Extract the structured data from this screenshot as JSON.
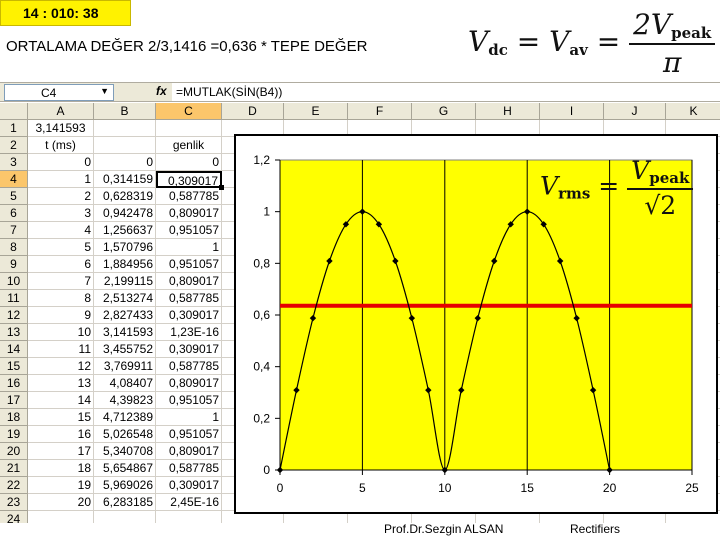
{
  "slide": {
    "timer": "14 : 010: 38",
    "headline": "ORTALAMA DEĞER 2/3,1416 =0,636 * TEPE DEĞER",
    "footer_credit": "Prof.Dr.Sezgin ALSAN",
    "footer_topic": "Rectifiers"
  },
  "formula_vdc": {
    "lhs1": "V",
    "lhs1_sub": "dc",
    "eq1": "=",
    "lhs2": "V",
    "lhs2_sub": "av",
    "eq2": "=",
    "num": "2V",
    "num_sub": "peak",
    "den": "π"
  },
  "formula_vrms": {
    "lhs": "V",
    "lhs_sub": "rms",
    "eq": "=",
    "num": "V",
    "num_sub": "peak",
    "den": "√2"
  },
  "formula_bar": {
    "name_box": "C4",
    "fx_label": "fx",
    "formula": "=MUTLAK(SİN(B4))"
  },
  "sheet": {
    "columns": [
      "A",
      "B",
      "C",
      "D",
      "E",
      "F",
      "G",
      "H",
      "I",
      "J",
      "K"
    ],
    "active_column": "C",
    "active_row": 4,
    "selected_cell": "C4",
    "row_numbers": [
      1,
      2,
      3,
      4,
      5,
      6,
      7,
      8,
      9,
      10,
      11,
      12,
      13,
      14,
      15,
      16,
      17,
      18,
      19,
      20,
      21,
      22,
      23,
      24
    ],
    "rows": [
      [
        "3,141593",
        "",
        ""
      ],
      [
        "t (ms)",
        "",
        "genlik"
      ],
      [
        "0",
        "0",
        "0"
      ],
      [
        "1",
        "0,314159",
        "0,309017"
      ],
      [
        "2",
        "0,628319",
        "0,587785"
      ],
      [
        "3",
        "0,942478",
        "0,809017"
      ],
      [
        "4",
        "1,256637",
        "0,951057"
      ],
      [
        "5",
        "1,570796",
        "1"
      ],
      [
        "6",
        "1,884956",
        "0,951057"
      ],
      [
        "7",
        "2,199115",
        "0,809017"
      ],
      [
        "8",
        "2,513274",
        "0,587785"
      ],
      [
        "9",
        "2,827433",
        "0,309017"
      ],
      [
        "10",
        "3,141593",
        "1,23E-16"
      ],
      [
        "11",
        "3,455752",
        "0,309017"
      ],
      [
        "12",
        "3,769911",
        "0,587785"
      ],
      [
        "13",
        "4,08407",
        "0,809017"
      ],
      [
        "14",
        "4,39823",
        "0,951057"
      ],
      [
        "15",
        "4,712389",
        "1"
      ],
      [
        "16",
        "5,026548",
        "0,951057"
      ],
      [
        "17",
        "5,340708",
        "0,809017"
      ],
      [
        "18",
        "5,654867",
        "0,587785"
      ],
      [
        "19",
        "5,969026",
        "0,309017"
      ],
      [
        "20",
        "6,283185",
        "2,45E-16"
      ]
    ]
  },
  "chart_data": {
    "type": "scatter",
    "x": [
      0,
      1,
      2,
      3,
      4,
      5,
      6,
      7,
      8,
      9,
      10,
      11,
      12,
      13,
      14,
      15,
      16,
      17,
      18,
      19,
      20
    ],
    "series": [
      {
        "values": [
          0,
          0.309017,
          0.587785,
          0.809017,
          0.951057,
          1,
          0.951057,
          0.809017,
          0.587785,
          0.309017,
          0,
          0.309017,
          0.587785,
          0.809017,
          0.951057,
          1,
          0.951057,
          0.809017,
          0.587785,
          0.309017,
          0
        ],
        "color": "#000000"
      }
    ],
    "reference_line": {
      "y": 0.636,
      "color": "#e60000"
    },
    "xlim": [
      0,
      25
    ],
    "ylim": [
      0,
      1.2
    ],
    "x_ticks": [
      0,
      5,
      10,
      15,
      20,
      25
    ],
    "y_ticks": [
      0,
      0.2,
      0.4,
      0.6,
      0.8,
      1,
      1.2
    ],
    "x_tick_labels": [
      "0",
      "5",
      "10",
      "15",
      "20",
      "25"
    ],
    "y_tick_labels": [
      "0",
      "0,2",
      "0,4",
      "0,6",
      "0,8",
      "1",
      "1,2"
    ],
    "plot_background": "#ffff00",
    "grid": "vertical",
    "smooth": true
  }
}
